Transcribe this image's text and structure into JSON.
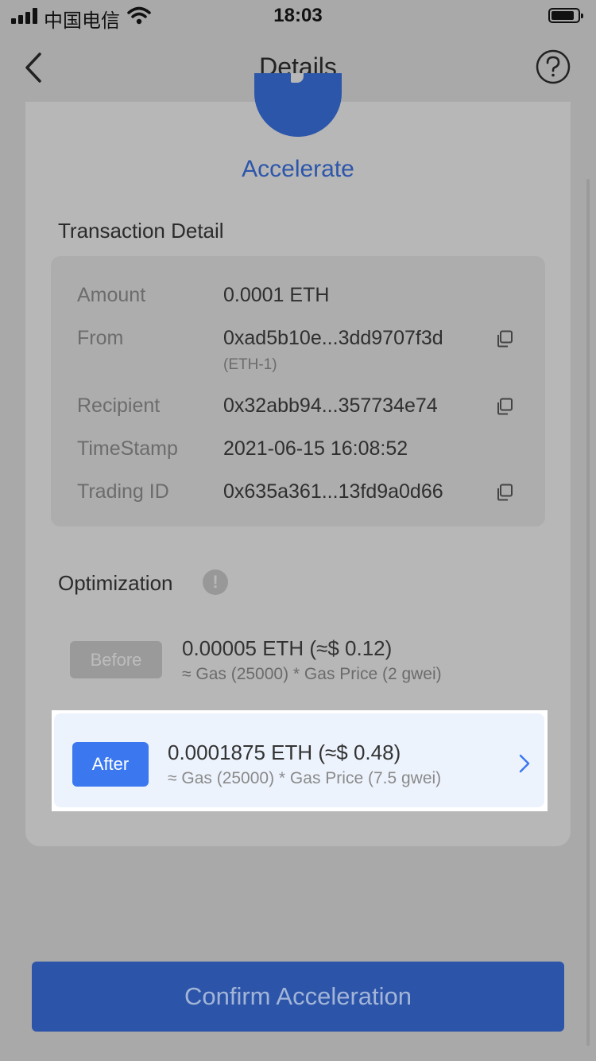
{
  "status_bar": {
    "carrier": "中国电信",
    "time": "18:03"
  },
  "nav": {
    "title": "Details"
  },
  "hero": {
    "label": "Accelerate"
  },
  "transaction_detail": {
    "title": "Transaction Detail",
    "rows": [
      {
        "label": "Amount",
        "value": "0.0001 ETH"
      },
      {
        "label": "From",
        "value": "0xad5b10e...3dd9707f3d",
        "sub": "(ETH-1)"
      },
      {
        "label": "Recipient",
        "value": "0x32abb94...357734e74"
      },
      {
        "label": "TimeStamp",
        "value": "2021-06-15 16:08:52"
      },
      {
        "label": "Trading ID",
        "value": "0x635a361...13fd9a0d66"
      }
    ]
  },
  "optimization": {
    "title": "Optimization",
    "info_icon": "!",
    "before": {
      "badge": "Before",
      "amount": "0.00005 ETH (≈$ 0.12)",
      "formula": "≈ Gas (25000) * Gas Price (2 gwei)"
    },
    "after": {
      "badge": "After",
      "amount": "0.0001875 ETH (≈$ 0.48)",
      "formula": "≈ Gas (25000) * Gas Price (7.5 gwei)"
    }
  },
  "confirm_button": {
    "label": "Confirm Acceleration"
  },
  "colors": {
    "accent": "#2c56a9",
    "after_badge": "#3b78f0",
    "overlay_background": "#a9a9a9"
  }
}
